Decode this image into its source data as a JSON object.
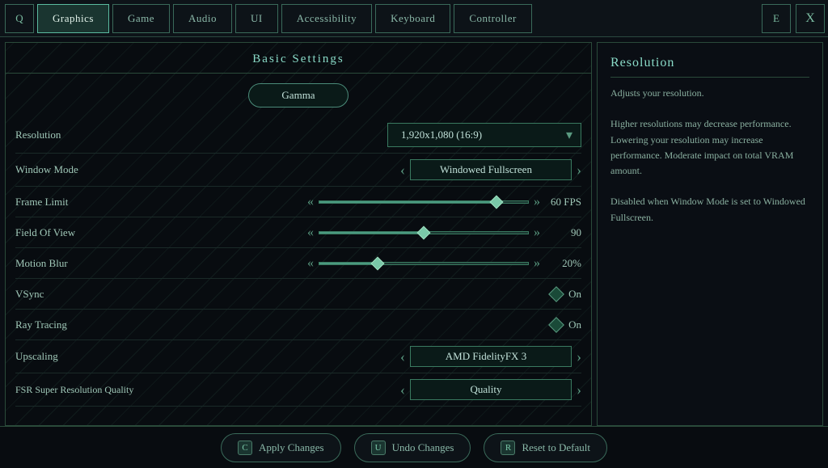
{
  "nav": {
    "icon_left": "Q",
    "icon_right": "E",
    "close": "X",
    "tabs": [
      {
        "label": "Graphics",
        "active": true
      },
      {
        "label": "Game",
        "active": false
      },
      {
        "label": "Audio",
        "active": false
      },
      {
        "label": "UI",
        "active": false
      },
      {
        "label": "Accessibility",
        "active": false
      },
      {
        "label": "Keyboard",
        "active": false
      },
      {
        "label": "Controller",
        "active": false
      }
    ]
  },
  "panel": {
    "title": "Basic Settings",
    "gamma_btn": "Gamma"
  },
  "settings": [
    {
      "label": "Resolution",
      "type": "dropdown",
      "value": "1,920x1,080 (16:9)"
    },
    {
      "label": "Window Mode",
      "type": "selector",
      "value": "Windowed Fullscreen"
    },
    {
      "label": "Frame Limit",
      "type": "slider",
      "value": "60 FPS",
      "fill": 0.85,
      "thumb": 0.85
    },
    {
      "label": "Field Of View",
      "type": "slider",
      "value": "90",
      "fill": 0.5,
      "thumb": 0.5
    },
    {
      "label": "Motion Blur",
      "type": "slider",
      "value": "20%",
      "fill": 0.28,
      "thumb": 0.28
    },
    {
      "label": "VSync",
      "type": "toggle",
      "value": "On"
    },
    {
      "label": "Ray Tracing",
      "type": "toggle",
      "value": "On"
    },
    {
      "label": "Upscaling",
      "type": "selector",
      "value": "AMD FidelityFX 3"
    },
    {
      "label": "FSR Super Resolution Quality",
      "type": "selector",
      "value": "Quality"
    }
  ],
  "info": {
    "title": "Resolution",
    "text": "Adjusts your resolution.\n\nHigher resolutions may decrease performance. Lowering your resolution may increase performance. Moderate impact on total VRAM amount.\n\nDisabled when Window Mode is set to Windowed Fullscreen."
  },
  "actions": [
    {
      "key": "C",
      "label": "Apply Changes"
    },
    {
      "key": "U",
      "label": "Undo Changes"
    },
    {
      "key": "R",
      "label": "Reset to Default"
    }
  ]
}
